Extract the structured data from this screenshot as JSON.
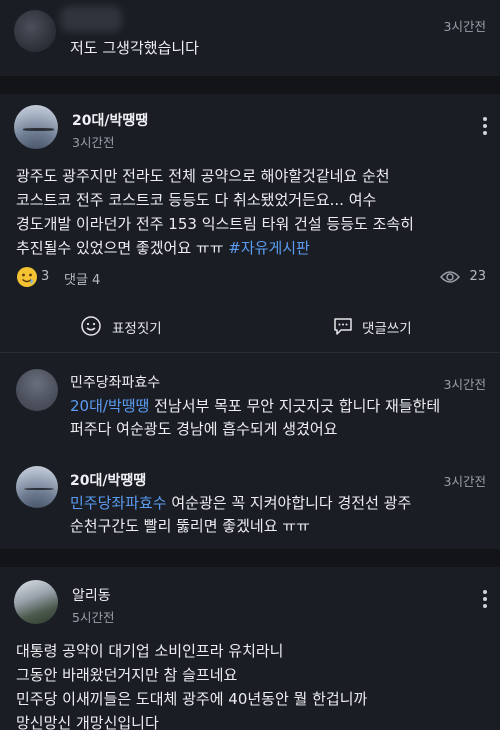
{
  "top_reply": {
    "time": "3시간전",
    "text": "저도 그생각했습니다"
  },
  "post": {
    "author": "20대/박땡땡",
    "time": "3시간전",
    "body_lines": [
      "광주도 광주지만 전라도 전체 공약으로 해야할것같네요 순천",
      "코스트코 전주 코스트코 등등도 다 취소됐었거든요... 여수",
      "경도개발 이라던가 전주 153 익스트림 타워 건설 등등도 조속히"
    ],
    "last_line_text": "추진될수 있었으면 좋겠어요 ㅠㅠ ",
    "hashtag": "#자유게시판",
    "reaction_count": "3",
    "comments_label": "댓글 4",
    "views": "23",
    "react_label": "표정짓기",
    "comment_write_label": "댓글쓰기"
  },
  "comments": [
    {
      "author": "민주당좌파효수",
      "time": "3시간전",
      "mention": "20대/박땡땡",
      "text_first": " 전남서부 목포 무안 지긋지긋 합니다 재들한테",
      "text_second": "퍼주다 여순광도 경남에 흡수되게 생겼어요"
    },
    {
      "author": "20대/박땡땡",
      "time": "3시간전",
      "mention": "민주당좌파효수",
      "text_first": " 여순광은 꼭 지켜야합니다 경전선 광주",
      "text_second": "순천구간도 빨리 뚫리면 좋겠네요 ㅠㅠ"
    }
  ],
  "post2": {
    "author": "알리동",
    "time": "5시간전",
    "body_lines": [
      "대통령 공약이 대기업 소비인프라 유치라니",
      "그동안 바래왔던거지만 참 슬프네요",
      "민주당 이새끼들은 도대체 광주에 40년동안 뭘 한겁니까",
      "망신망신 개망신입니다"
    ]
  },
  "colors": {
    "background": "#1a1d23",
    "separator": "#121418",
    "link": "#5b9cf2",
    "muted": "#9a9ea8"
  },
  "icons": [
    "more-vertical-icon",
    "emoji-reaction-icon",
    "eye-icon",
    "smile-icon",
    "comment-bubble-icon"
  ]
}
